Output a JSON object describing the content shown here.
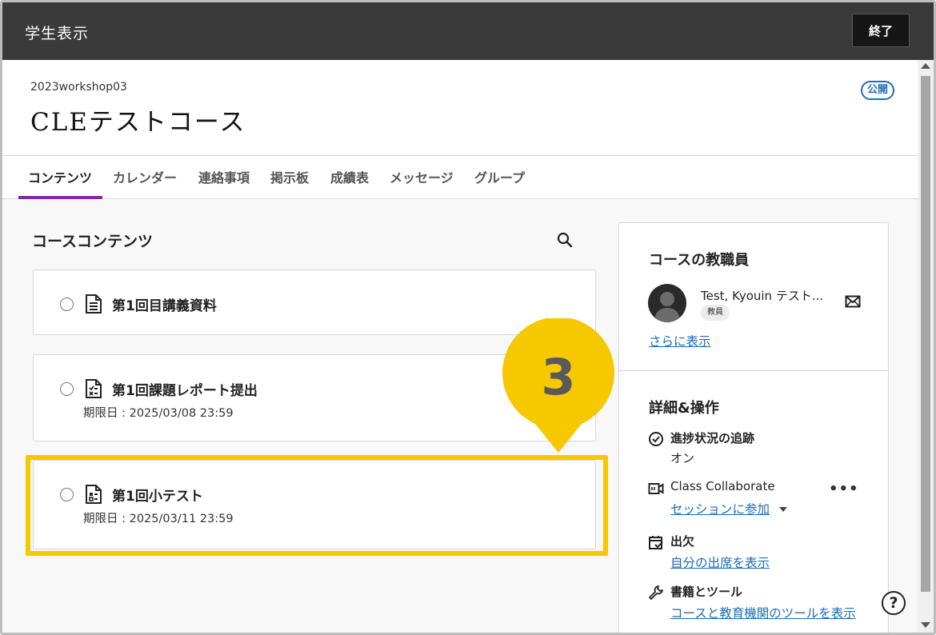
{
  "topbar": {
    "title": "学生表示",
    "exit_label": "終了"
  },
  "course": {
    "id": "2023workshop03",
    "title": "CLEテストコース",
    "badge": "公開"
  },
  "tabs": [
    {
      "label": "コンテンツ",
      "active": true
    },
    {
      "label": "カレンダー"
    },
    {
      "label": "連絡事項"
    },
    {
      "label": "掲示板"
    },
    {
      "label": "成績表"
    },
    {
      "label": "メッセージ"
    },
    {
      "label": "グループ"
    }
  ],
  "content": {
    "section_title": "コースコンテンツ",
    "items": [
      {
        "title": "第1回目講義資料",
        "icon": "document-icon"
      },
      {
        "title": "第1回課題レポート提出",
        "due": "期限日 : 2025/03/08 23:59",
        "icon": "assignment-icon"
      },
      {
        "title": "第1回小テスト",
        "due": "期限日 : 2025/03/11 23:59",
        "icon": "test-icon"
      }
    ]
  },
  "callout": {
    "number": "3",
    "color": "#f5c800"
  },
  "panel": {
    "staff_heading": "コースの教職員",
    "staff_name": "Test, Kyouin テスト...",
    "staff_role": "教員",
    "more_link": "さらに表示",
    "details_heading": "詳細&操作",
    "progress_label": "進捗状況の追跡",
    "progress_value": "オン",
    "collab_label": "Class Collaborate",
    "collab_link": "セッションに参加",
    "attendance_label": "出欠",
    "attendance_link": "自分の出席を表示",
    "tools_label": "書籍とツール",
    "tools_link": "コースと教育機関のツールを表示"
  },
  "help": {
    "label": "?"
  },
  "colors": {
    "accent_tab": "#7e2aa8",
    "link": "#1c6cb6",
    "highlight": "#f5c800"
  }
}
